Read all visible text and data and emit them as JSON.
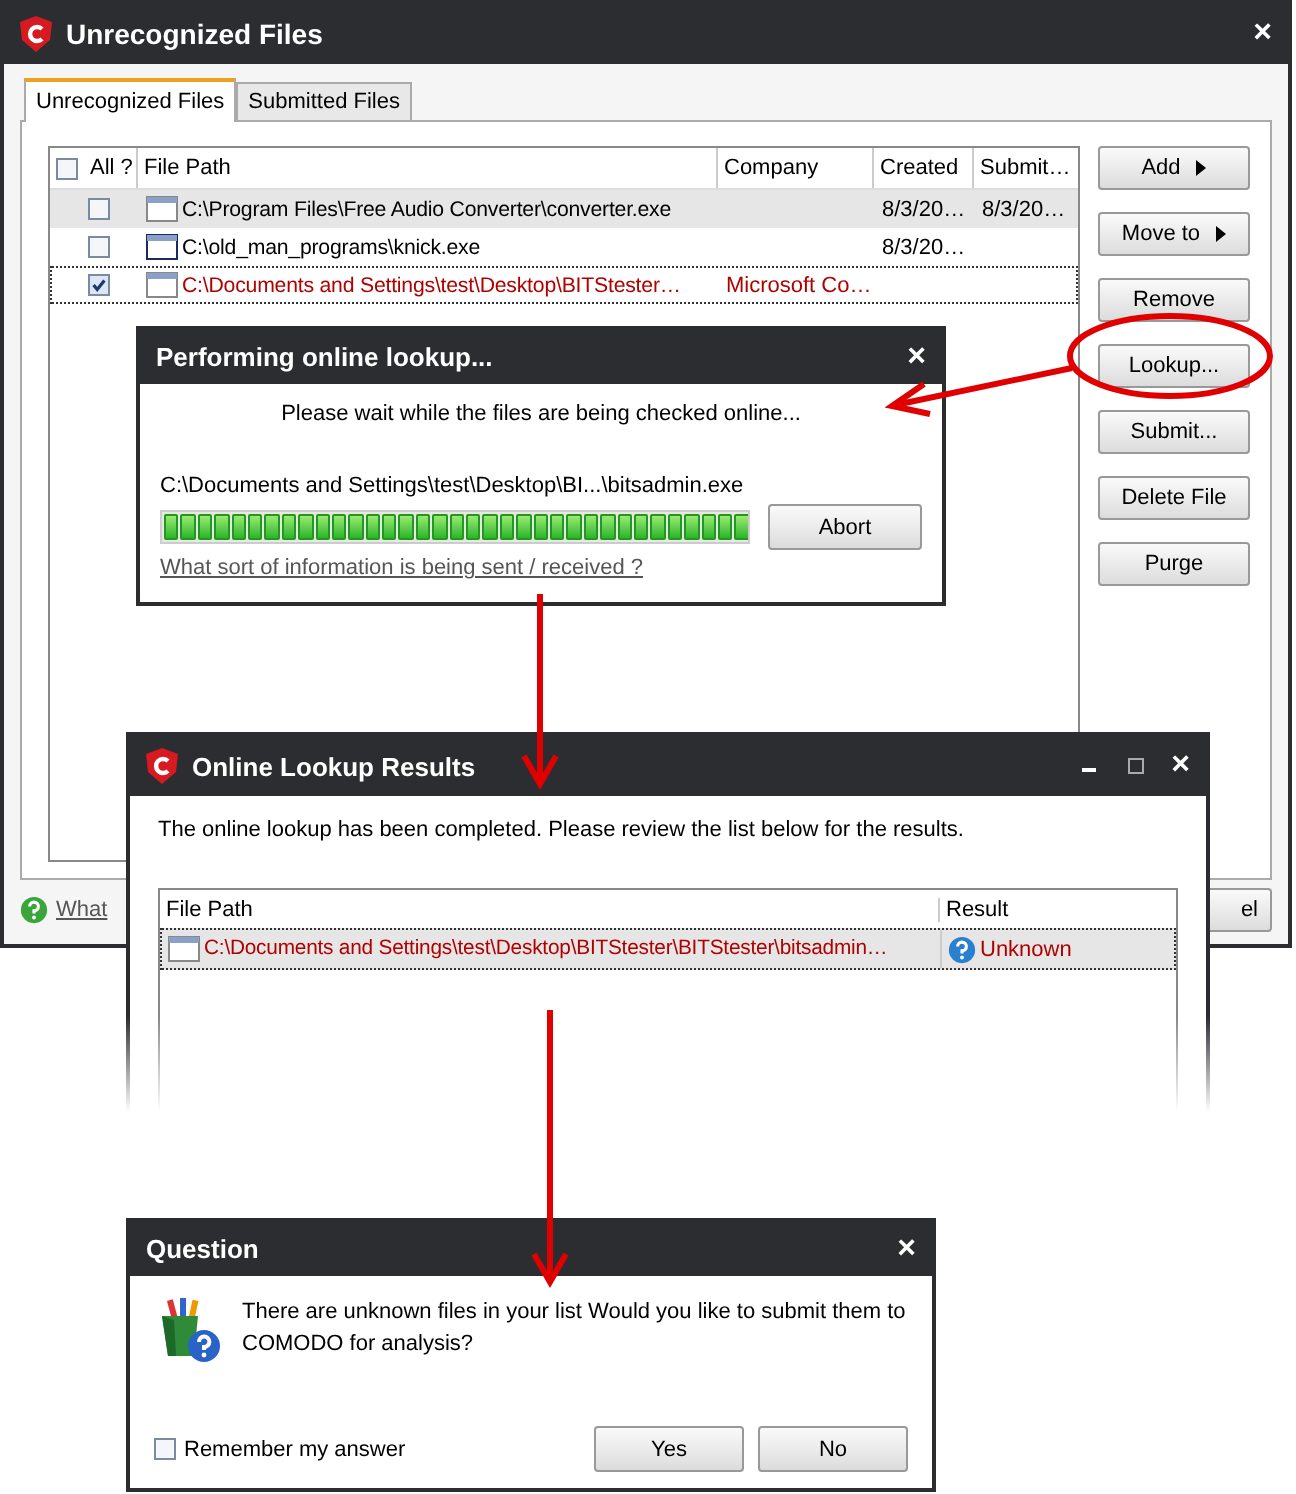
{
  "main_window": {
    "title": "Unrecognized Files",
    "close": "×",
    "tabs": [
      {
        "label": "Unrecognized Files",
        "selected": true
      },
      {
        "label": "Submitted Files",
        "selected": false
      }
    ],
    "table": {
      "all_label": "All ?",
      "all_checked": false,
      "columns": [
        "File Path",
        "Company",
        "Created",
        "Submit…"
      ],
      "rows": [
        {
          "checked": false,
          "shaded": true,
          "focused": false,
          "color": "#000000",
          "cells": [
            "C:\\Program Files\\Free Audio Converter\\converter.exe",
            "",
            "8/3/20…",
            "8/3/20…"
          ]
        },
        {
          "checked": false,
          "shaded": false,
          "focused": false,
          "color": "#000000",
          "cells": [
            "C:\\old_man_programs\\knick.exe",
            "",
            "8/3/20…",
            ""
          ]
        },
        {
          "checked": true,
          "shaded": false,
          "focused": true,
          "color": "#b00000",
          "cells": [
            "C:\\Documents and Settings\\test\\Desktop\\BITStester…",
            "Microsoft Co…",
            "",
            ""
          ]
        }
      ]
    },
    "buttons": [
      {
        "label": "Add",
        "menu": true
      },
      {
        "label": "Move to",
        "menu": true
      },
      {
        "label": "Remove",
        "menu": false
      },
      {
        "label": "Lookup...",
        "menu": false
      },
      {
        "label": "Submit...",
        "menu": false
      },
      {
        "label": "Delete File",
        "menu": false
      },
      {
        "label": "Purge",
        "menu": false
      }
    ],
    "help_link": "What",
    "cancel_button": "el"
  },
  "lookup_dialog": {
    "title": "Performing online lookup...",
    "close": "×",
    "message": "Please wait while the files are being checked online...",
    "current_file": "C:\\Documents and Settings\\test\\Desktop\\BI...\\bitsadmin.exe",
    "level": 1,
    "abort_button": "Abort",
    "info_link": "What sort of information is being sent / received ?"
  },
  "results_dialog": {
    "title": "Online Lookup Results",
    "close": "×",
    "message": "The online lookup has been completed. Please review the list below for the results.",
    "columns": [
      "File Path",
      "Result"
    ],
    "rows": [
      {
        "path": "C:\\Documents and Settings\\test\\Desktop\\BITStester\\BITStester\\bitsadmin…",
        "result": "Unknown",
        "color": "#b00000"
      }
    ]
  },
  "question_dialog": {
    "title": "Question",
    "close": "×",
    "message": "There are unknown files in your list Would you like to submit them to COMODO for analysis?",
    "remember": {
      "label": "Remember my answer",
      "checked": false
    },
    "buttons": [
      "Yes",
      "No"
    ]
  }
}
